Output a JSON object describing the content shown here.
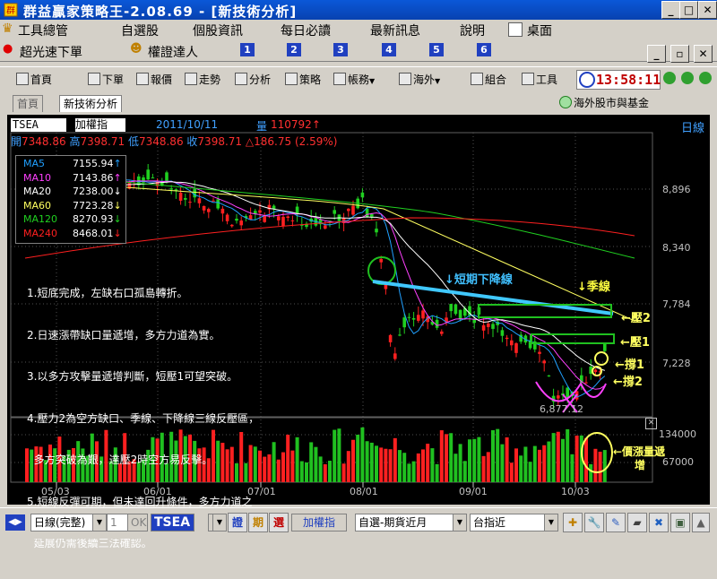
{
  "window": {
    "title": "群益贏家策略王-2.08.69 - [新技術分析]"
  },
  "menu": {
    "items": [
      "工具總管",
      "自選股",
      "個股資訊",
      "每日必讀",
      "最新訊息",
      "說明",
      "桌面"
    ]
  },
  "menu2": {
    "items": [
      "超光速下單",
      "權證達人"
    ],
    "numbers": [
      "1",
      "2",
      "3",
      "4",
      "5",
      "6"
    ]
  },
  "toolbar": {
    "items": [
      "首頁",
      "下單",
      "報價",
      "走勢",
      "分析",
      "策略",
      "帳務",
      "海外",
      "組合",
      "工具"
    ],
    "clock": "13:58:11"
  },
  "tabs": {
    "items": [
      "首頁",
      "新技術分析"
    ],
    "right": "海外股市與基金"
  },
  "chart_data": {
    "type": "candlestick",
    "symbol": "TSEA",
    "name": "加權指",
    "date": "2011/10/11",
    "period": "日線",
    "vol_label": "量",
    "vol_value": "110792",
    "ohlc_labels": {
      "open": "開",
      "high": "高",
      "low": "低",
      "close": "收"
    },
    "open": 7348.86,
    "high": 7398.71,
    "low": 7348.86,
    "close": 7398.71,
    "change": "186.75",
    "change_pct": "(2.59%)",
    "ma": [
      {
        "name": "MA5",
        "value": "7155.94",
        "color": "#20a0ff",
        "arrow": "up"
      },
      {
        "name": "MA10",
        "value": "7143.86",
        "color": "#ff40ff",
        "arrow": "up"
      },
      {
        "name": "MA20",
        "value": "7238.00",
        "color": "#ffffff",
        "arrow": "down"
      },
      {
        "name": "MA60",
        "value": "7723.28",
        "color": "#ffff60",
        "arrow": "down"
      },
      {
        "name": "MA120",
        "value": "8270.93",
        "color": "#20d020",
        "arrow": "down"
      },
      {
        "name": "MA240",
        "value": "8468.01",
        "color": "#ff2020",
        "arrow": "down"
      }
    ],
    "y_ticks": [
      "8,896",
      "8,340",
      "7,784",
      "7,228"
    ],
    "vol_ticks": [
      "134000",
      "67000"
    ],
    "x_ticks": [
      "05/03",
      "06/01",
      "07/01",
      "08/01",
      "09/01",
      "10/03"
    ],
    "low_label": "6,877.12",
    "notes": [
      "1.短底完成，左缺右口孤島轉折。",
      "2.日速漲帶缺口量遞增，多方力道為實。",
      "3.以多方攻擊量遞增判斷，短壓1可望突破。",
      "4.壓力2為空方缺口、季線、下降線三線反壓區，",
      "  多方突破為艱，達壓2時空方易反擊。",
      "5.短線反彈可期，但未達回升條件，多方力道之",
      "  延展仍需後續三法確認。"
    ],
    "annotations": {
      "trend": "↓短期下降線",
      "quarter": "↓季線",
      "res2": "←壓2",
      "res1": "←壓1",
      "sup1": "←撐1",
      "sup2": "←撐2",
      "vol1": "←價漲量遞",
      "vol2": "增"
    }
  },
  "status": {
    "period_select": "日線(完整)",
    "count": "1",
    "ok": "OK",
    "symbol": "TSEA",
    "b1": "證",
    "b2": "期",
    "b3": "選",
    "name": "加權指",
    "select1": "自選-期貨近月",
    "select2": "台指近"
  }
}
